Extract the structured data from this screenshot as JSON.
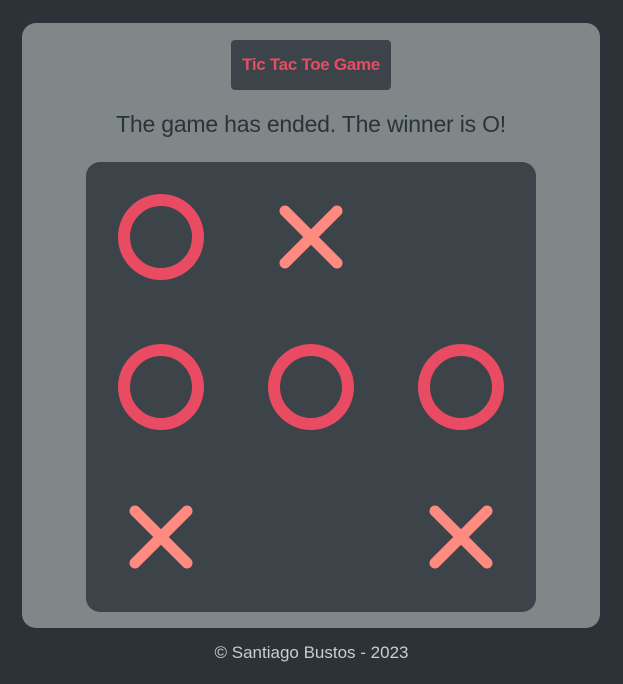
{
  "header": {
    "title": "Tic Tac Toe Game"
  },
  "status": {
    "message": "The game has ended. The winner is O!"
  },
  "board": {
    "cells": [
      "O",
      "X",
      "",
      "O",
      "O",
      "O",
      "X",
      "",
      "X"
    ],
    "colors": {
      "o_mark": "#e94b62",
      "x_mark": "#ff8a80",
      "board_bg": "#3d4449",
      "card_bg": "#7f8789",
      "page_bg": "#2b3339"
    }
  },
  "footer": {
    "text": "© Santiago Bustos - 2023"
  }
}
